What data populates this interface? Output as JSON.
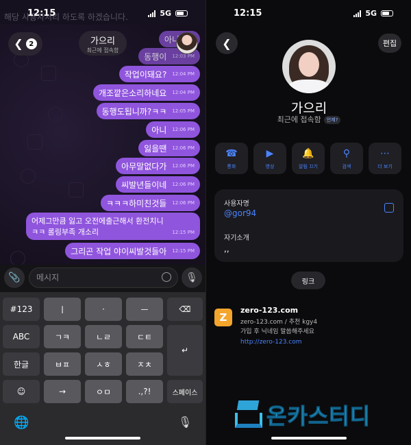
{
  "left": {
    "status": {
      "time": "12:15",
      "network": "5G"
    },
    "notification_text": "해당 사용자처리 하도록 하겠습니다.",
    "header": {
      "unread_count": "2",
      "name": "가으리",
      "status": "최근에 접속함"
    },
    "messages": [
      {
        "text": "아니씨발",
        "time": ""
      },
      {
        "text": "동행이",
        "time": "12:03 PM"
      },
      {
        "text": "작업이돼요?",
        "time": "12:04 PM"
      },
      {
        "text": "개조깥은소리하네요",
        "time": "12:04 PM"
      },
      {
        "text": "동행도됩니까?ㅋㅋ",
        "time": "12:05 PM"
      },
      {
        "text": "아니",
        "time": "12:06 PM"
      },
      {
        "text": "잃을땐",
        "time": "12:06 PM"
      },
      {
        "text": "아무말없다가",
        "time": "12:06 PM"
      },
      {
        "text": "씨발년들이네",
        "time": "12:06 PM"
      },
      {
        "text": "ㅋㅋㅋ하미친것들",
        "time": "12:06 PM"
      },
      {
        "text": "어제그만큼 잃고 오전에출근해서 환전치니 ㅋㅋ 롤링부족 개소리",
        "time": "12:15 PM"
      },
      {
        "text": "그리곤 작업 야이씨발것들아",
        "time": "12:15 PM"
      }
    ],
    "composer": {
      "placeholder": "메시지"
    },
    "keyboard": {
      "row1": [
        "#123",
        "ㅣ",
        "·",
        "ㅡ"
      ],
      "row2": [
        "ABC",
        "ㄱㅋ",
        "ㄴㄹ",
        "ㄷㅌ"
      ],
      "row3": [
        "한글",
        "ㅂㅍ",
        "ㅅㅎ",
        "ㅈㅊ"
      ],
      "row4": [
        "→",
        "ㅇㅁ",
        ".,?!",
        "스페이스"
      ]
    }
  },
  "right": {
    "status": {
      "time": "12:15",
      "network": "5G"
    },
    "edit_label": "편집",
    "name": "가으리",
    "last_seen": "최근에 접속함",
    "last_seen_tag": "언제?",
    "actions": [
      {
        "icon": "phone-icon",
        "label": "통화"
      },
      {
        "icon": "video-icon",
        "label": "영상"
      },
      {
        "icon": "bell-icon",
        "label": "알림 끄기"
      },
      {
        "icon": "search-icon",
        "label": "검색"
      },
      {
        "icon": "more-icon",
        "label": "더 보기"
      }
    ],
    "username_label": "사용자명",
    "username": "@gor94",
    "bio_label": "자기소개",
    "bio": ",,",
    "link_button": "링크",
    "link_preview": {
      "logo_letter": "Z",
      "title": "zero-123.com",
      "line1": "zero-123.com / 추천 kgy4",
      "line2": "가입 후 닉네임 말씀해주세요",
      "url": "http://zero-123.com"
    },
    "watermark": "온카스터디"
  },
  "colors": {
    "bubble": "#9055dd",
    "accent": "#4b84ff",
    "logo": "#f3a52c"
  }
}
